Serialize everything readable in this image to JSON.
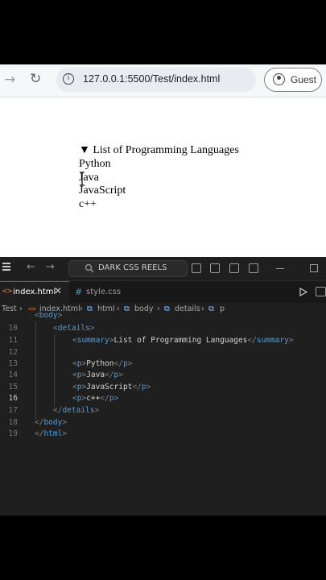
{
  "browser": {
    "url": "127.0.0.1:5500/Test/index.html",
    "guest_label": "Guest",
    "icons": {
      "back": "arrow-right-icon",
      "reload": "reload-icon",
      "info": "info-icon",
      "profile": "profile-icon"
    }
  },
  "page": {
    "summary": "List of Programming Languages",
    "items": [
      "Python",
      "Java",
      "JavaScript",
      "c++"
    ]
  },
  "vscode": {
    "command_center": "DARK CSS REELS",
    "tabs": [
      {
        "label": "index.html",
        "active": true
      },
      {
        "label": "style.css",
        "active": false
      }
    ],
    "breadcrumb": [
      "Test",
      "index.html",
      "html",
      "body",
      "details",
      "p"
    ],
    "lines": [
      {
        "no": "10",
        "code": "<details>"
      },
      {
        "no": "11",
        "code": "<summary>List of Programming Languages</summary>"
      },
      {
        "no": "12",
        "code": ""
      },
      {
        "no": "13",
        "code": "<p>Python</p>"
      },
      {
        "no": "14",
        "code": "<p>Java</p>"
      },
      {
        "no": "15",
        "code": "<p>JavaScript</p>"
      },
      {
        "no": "16",
        "code": "<p>c++</p>"
      },
      {
        "no": "17",
        "code": "</details>"
      },
      {
        "no": "18",
        "code": "</body>"
      },
      {
        "no": "19",
        "code": "</html>"
      }
    ],
    "colors": {
      "tag": "#569cd6",
      "bracket": "#808080",
      "text": "#d4d4d4",
      "accent": "#0078d4"
    }
  }
}
